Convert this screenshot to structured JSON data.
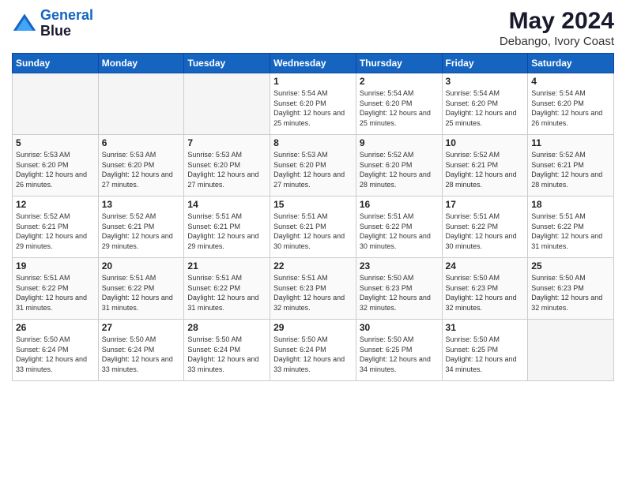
{
  "header": {
    "logo_line1": "General",
    "logo_line2": "Blue",
    "month_year": "May 2024",
    "location": "Debango, Ivory Coast"
  },
  "days_of_week": [
    "Sunday",
    "Monday",
    "Tuesday",
    "Wednesday",
    "Thursday",
    "Friday",
    "Saturday"
  ],
  "weeks": [
    [
      {
        "day": "",
        "empty": true
      },
      {
        "day": "",
        "empty": true
      },
      {
        "day": "",
        "empty": true
      },
      {
        "day": "1",
        "sunrise": "5:54 AM",
        "sunset": "6:20 PM",
        "daylight": "12 hours and 25 minutes."
      },
      {
        "day": "2",
        "sunrise": "5:54 AM",
        "sunset": "6:20 PM",
        "daylight": "12 hours and 25 minutes."
      },
      {
        "day": "3",
        "sunrise": "5:54 AM",
        "sunset": "6:20 PM",
        "daylight": "12 hours and 25 minutes."
      },
      {
        "day": "4",
        "sunrise": "5:54 AM",
        "sunset": "6:20 PM",
        "daylight": "12 hours and 26 minutes."
      }
    ],
    [
      {
        "day": "5",
        "sunrise": "5:53 AM",
        "sunset": "6:20 PM",
        "daylight": "12 hours and 26 minutes."
      },
      {
        "day": "6",
        "sunrise": "5:53 AM",
        "sunset": "6:20 PM",
        "daylight": "12 hours and 27 minutes."
      },
      {
        "day": "7",
        "sunrise": "5:53 AM",
        "sunset": "6:20 PM",
        "daylight": "12 hours and 27 minutes."
      },
      {
        "day": "8",
        "sunrise": "5:53 AM",
        "sunset": "6:20 PM",
        "daylight": "12 hours and 27 minutes."
      },
      {
        "day": "9",
        "sunrise": "5:52 AM",
        "sunset": "6:20 PM",
        "daylight": "12 hours and 28 minutes."
      },
      {
        "day": "10",
        "sunrise": "5:52 AM",
        "sunset": "6:21 PM",
        "daylight": "12 hours and 28 minutes."
      },
      {
        "day": "11",
        "sunrise": "5:52 AM",
        "sunset": "6:21 PM",
        "daylight": "12 hours and 28 minutes."
      }
    ],
    [
      {
        "day": "12",
        "sunrise": "5:52 AM",
        "sunset": "6:21 PM",
        "daylight": "12 hours and 29 minutes."
      },
      {
        "day": "13",
        "sunrise": "5:52 AM",
        "sunset": "6:21 PM",
        "daylight": "12 hours and 29 minutes."
      },
      {
        "day": "14",
        "sunrise": "5:51 AM",
        "sunset": "6:21 PM",
        "daylight": "12 hours and 29 minutes."
      },
      {
        "day": "15",
        "sunrise": "5:51 AM",
        "sunset": "6:21 PM",
        "daylight": "12 hours and 30 minutes."
      },
      {
        "day": "16",
        "sunrise": "5:51 AM",
        "sunset": "6:22 PM",
        "daylight": "12 hours and 30 minutes."
      },
      {
        "day": "17",
        "sunrise": "5:51 AM",
        "sunset": "6:22 PM",
        "daylight": "12 hours and 30 minutes."
      },
      {
        "day": "18",
        "sunrise": "5:51 AM",
        "sunset": "6:22 PM",
        "daylight": "12 hours and 31 minutes."
      }
    ],
    [
      {
        "day": "19",
        "sunrise": "5:51 AM",
        "sunset": "6:22 PM",
        "daylight": "12 hours and 31 minutes."
      },
      {
        "day": "20",
        "sunrise": "5:51 AM",
        "sunset": "6:22 PM",
        "daylight": "12 hours and 31 minutes."
      },
      {
        "day": "21",
        "sunrise": "5:51 AM",
        "sunset": "6:22 PM",
        "daylight": "12 hours and 31 minutes."
      },
      {
        "day": "22",
        "sunrise": "5:51 AM",
        "sunset": "6:23 PM",
        "daylight": "12 hours and 32 minutes."
      },
      {
        "day": "23",
        "sunrise": "5:50 AM",
        "sunset": "6:23 PM",
        "daylight": "12 hours and 32 minutes."
      },
      {
        "day": "24",
        "sunrise": "5:50 AM",
        "sunset": "6:23 PM",
        "daylight": "12 hours and 32 minutes."
      },
      {
        "day": "25",
        "sunrise": "5:50 AM",
        "sunset": "6:23 PM",
        "daylight": "12 hours and 32 minutes."
      }
    ],
    [
      {
        "day": "26",
        "sunrise": "5:50 AM",
        "sunset": "6:24 PM",
        "daylight": "12 hours and 33 minutes."
      },
      {
        "day": "27",
        "sunrise": "5:50 AM",
        "sunset": "6:24 PM",
        "daylight": "12 hours and 33 minutes."
      },
      {
        "day": "28",
        "sunrise": "5:50 AM",
        "sunset": "6:24 PM",
        "daylight": "12 hours and 33 minutes."
      },
      {
        "day": "29",
        "sunrise": "5:50 AM",
        "sunset": "6:24 PM",
        "daylight": "12 hours and 33 minutes."
      },
      {
        "day": "30",
        "sunrise": "5:50 AM",
        "sunset": "6:25 PM",
        "daylight": "12 hours and 34 minutes."
      },
      {
        "day": "31",
        "sunrise": "5:50 AM",
        "sunset": "6:25 PM",
        "daylight": "12 hours and 34 minutes."
      },
      {
        "day": "",
        "empty": true
      }
    ]
  ]
}
